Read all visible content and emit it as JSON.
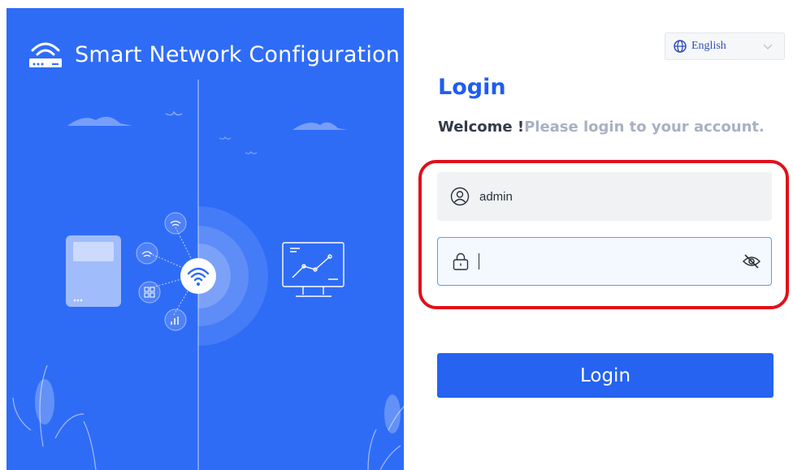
{
  "app": {
    "title": "Smart Network Configuration"
  },
  "language": {
    "selected": "English",
    "icon": "globe-icon",
    "dropdown_icon": "chevron-down-icon"
  },
  "login": {
    "title": "Login",
    "welcome_prefix": "Welcome !",
    "welcome_suffix": "Please login to your account.",
    "username": {
      "value": "admin",
      "icon": "user-icon"
    },
    "password": {
      "value": "",
      "icon": "lock-icon",
      "toggle_icon": "eye-off-icon"
    },
    "button_label": "Login"
  },
  "colors": {
    "brand_blue": "#2f6cf6",
    "button_blue": "#2563f0",
    "title_blue": "#1f5cf0",
    "highlight_red": "#e0101a"
  }
}
